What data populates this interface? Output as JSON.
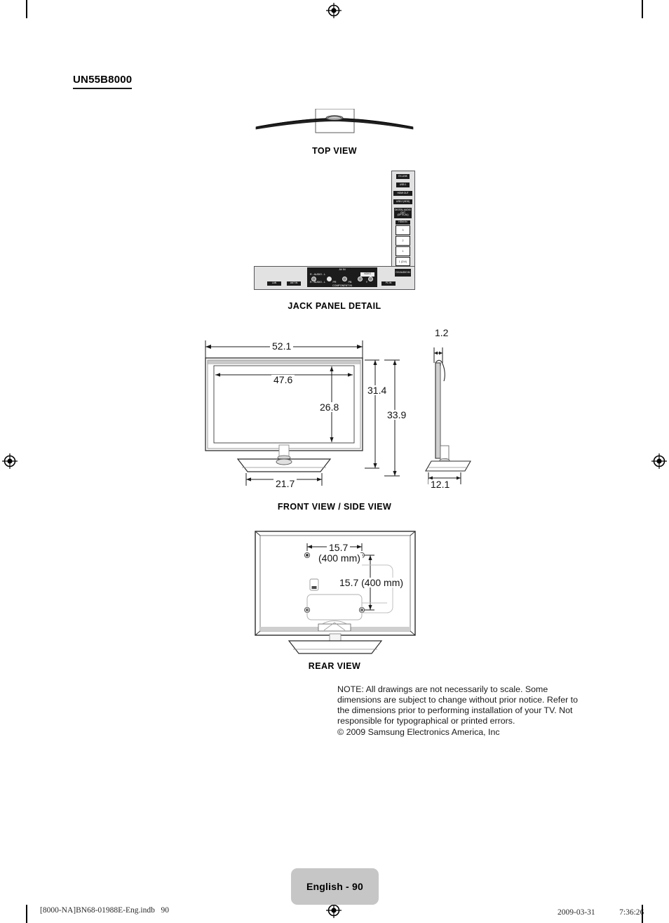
{
  "page": {
    "model": "UN55B8000",
    "language_badge": "English - 90",
    "footer_left": "[8000-NA]BN68-01988E-Eng.indb   90",
    "footer_right": "2009-03-31   　　 7:36:26"
  },
  "captions": {
    "top_view": "TOP VIEW",
    "jack_panel": "JACK PANEL DETAIL",
    "front_side_view": "FRONT VIEW / SIDE VIEW",
    "rear_view": "REAR VIEW"
  },
  "dimensions": {
    "front_outer_width": "52.1",
    "screen_width": "47.6",
    "screen_height": "26.8",
    "panel_height": "31.4",
    "total_height": "33.9",
    "stand_width": "21.7",
    "panel_depth": "1.2",
    "stand_depth": "12.1",
    "vesa_horizontal": "15.7",
    "vesa_horizontal_mm": "(400 mm)",
    "vesa_vertical": "15.7 (400 mm)"
  },
  "jack_panel": {
    "vertical_labels": [
      "EX-LINK",
      "USB 1",
      "HDMI OUT",
      "USB 2 (HDD)",
      "DIGITAL AUDIO OUT (OPTICAL)"
    ],
    "hdmi_header": "HDMI IN",
    "hdmi_slots": [
      "3",
      "2",
      "1",
      "1 (DVI)"
    ],
    "dvi_audio_label": "DVI AUDIO IN",
    "av_in": "AV IN",
    "component_in": "COMPONENT IN",
    "video": "VIDEO",
    "audio_r": "R - AUDIO - L",
    "audio_r2": "R - AUDIO - L",
    "pr": "PR",
    "pb": "PB",
    "y": "Y",
    "lan": "LAN",
    "ant_in": "ANT IN",
    "pc_in": "PC IN"
  },
  "notes": {
    "body": "NOTE: All drawings are not necessarily to scale. Some dimensions are subject to change without prior notice. Refer to the dimensions prior to performing installation of your TV. Not responsible for typographical or printed errors.",
    "copyright": "© 2009 Samsung Electronics America, Inc"
  }
}
